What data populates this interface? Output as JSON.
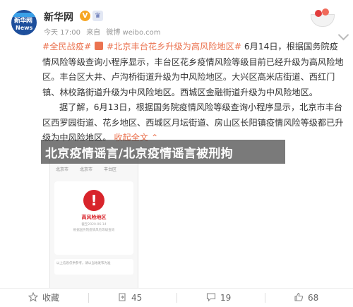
{
  "header": {
    "username": "新华网",
    "verified_badge": "V",
    "avatar_text_top": "新华网",
    "avatar_text_bottom": "News",
    "meta": {
      "date": "今天 17:00",
      "source_prefix": "来自",
      "source": "微博 weibo.com"
    }
  },
  "post": {
    "line1_tag": "#全民战疫#",
    "line1_topic": "#北京丰台花乡升级为高风险地区#",
    "line1_rest": " 6月14日，根据国务院疫情风险等级查询小程序显示，丰台区花乡疫情风险等级目前已经升级为高风险地区。丰台区大井、卢沟桥街道升级为中风险地区。大兴区高米店街道、西红门镇、林校路街道升级为中风险地区。西城区金融街道升级为中风险地区。",
    "para2": "据了解，6月13日，根据国务院疫情风险等级查询小程序显示，北京市丰台区西罗园街道、花乡地区、西城区月坛街道、房山区长阳镇疫情风险等级都已升级为中风险地区。",
    "collapse_label": "收起全文",
    "collapse_icon": "chevron-up"
  },
  "image": {
    "header_left": "北京市",
    "header_mid": "北京市",
    "header_right": "丰台区",
    "risk_label": "高风险地区",
    "update_time": "截至2020-06-14",
    "desc": "根据国务院疫情风险等级查询",
    "note": "以上信息仅供参考，请以当地发布为准"
  },
  "banner": {
    "title": "北京疫情谣言/北京疫情谣言被刑拘"
  },
  "actions": {
    "favorite_label": "收藏",
    "repost_count": "45",
    "comment_count": "19",
    "like_count": "68"
  },
  "colors": {
    "accent": "#eb7350",
    "banner_bg": "#464646",
    "risk_red": "#d8242b"
  }
}
